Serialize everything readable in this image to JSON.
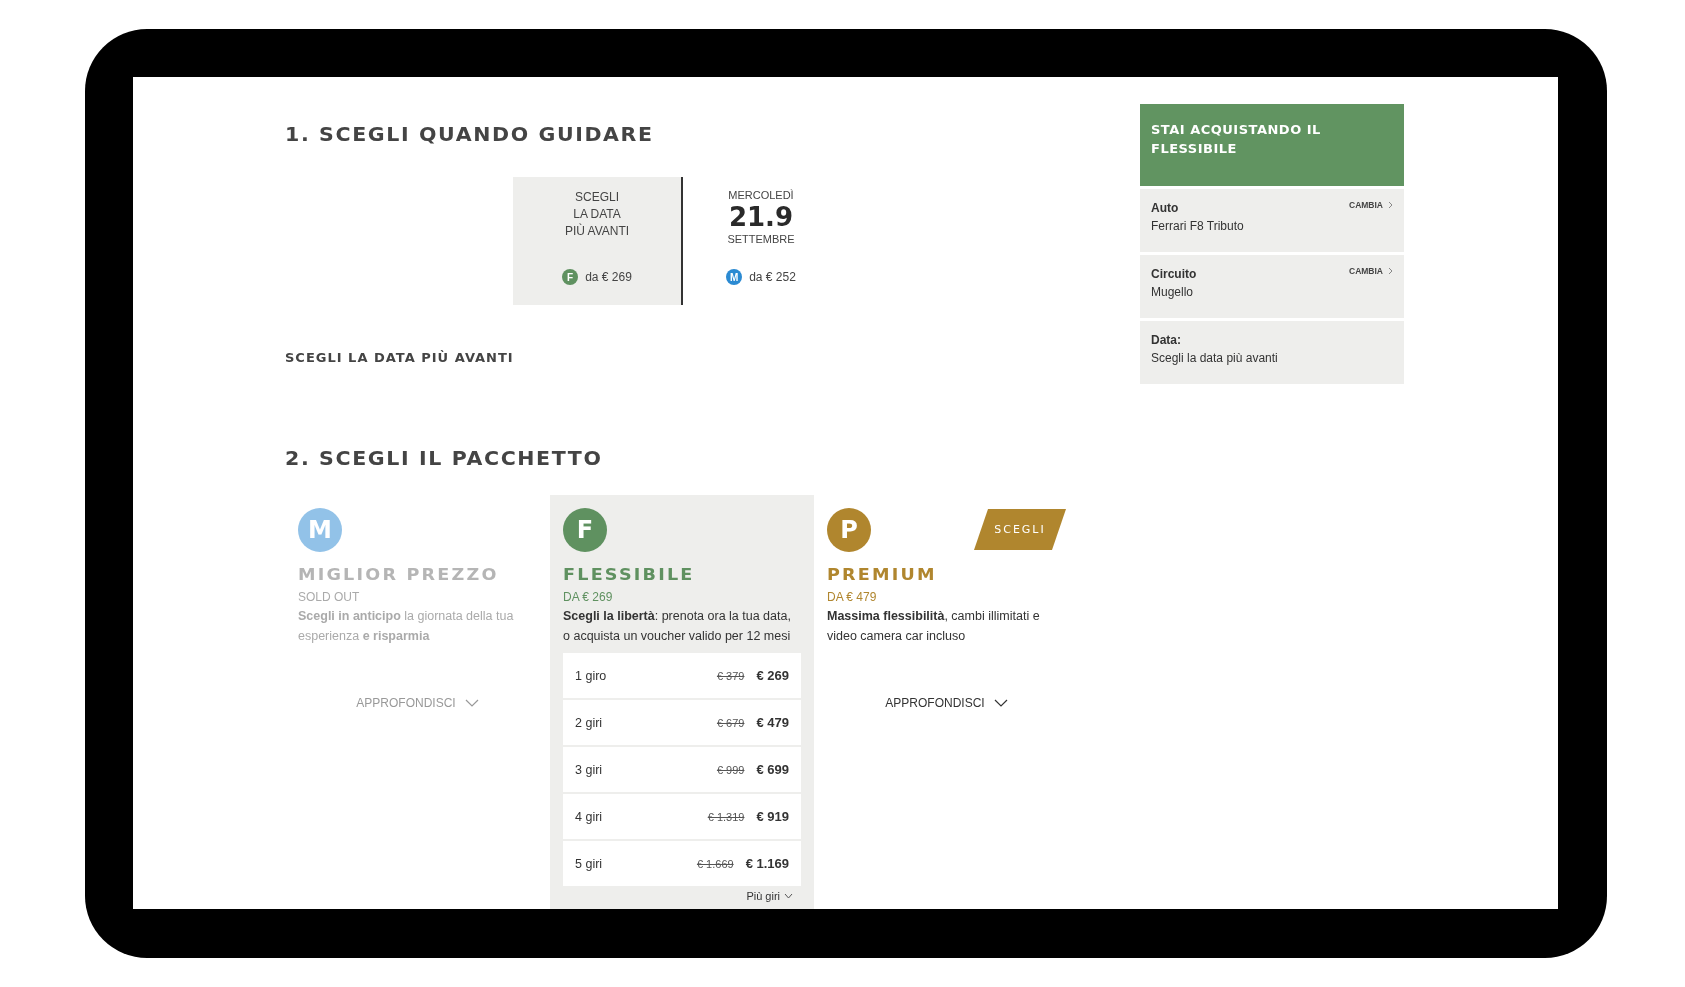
{
  "step1": {
    "title": "1. SCEGLI QUANDO GUIDARE",
    "date_options": [
      {
        "kind": "flexible",
        "lines": [
          "SCEGLI",
          "LA DATA",
          "PIÙ AVANTI"
        ],
        "badge": "F",
        "color": "#5f9160",
        "price": "da € 269",
        "selected": true
      },
      {
        "kind": "date",
        "weekday": "MERCOLEDÌ",
        "day": "21.9",
        "month": "SETTEMBRE",
        "badge": "M",
        "color": "#2b8ad2",
        "price": "da € 252",
        "selected": false
      }
    ],
    "selection_label": "SCEGLI LA DATA PIÙ AVANTI"
  },
  "step2": {
    "title": "2. SCEGLI IL PACCHETTO",
    "packages": [
      {
        "badge": "M",
        "name": "MIGLIOR PREZZO",
        "color": "#92c2e8",
        "status": "SOLD OUT",
        "sold_out": true,
        "selected": false,
        "description": "**Scegli in anticipo** la giornata della tua esperienza **e risparmia**",
        "more": "APPROFONDISCI"
      },
      {
        "badge": "F",
        "name": "FLESSIBILE",
        "color": "#5f9160",
        "price": "DA € 269",
        "sold_out": false,
        "selected": true,
        "description": "**Scegli la libertà**: prenota ora la tua data, o acquista un voucher valido per 12 mesi",
        "rows": [
          {
            "label": "1 giro",
            "old_price": "€ 379",
            "price": "€ 269"
          },
          {
            "label": "2 giri",
            "old_price": "€ 679",
            "price": "€ 479"
          },
          {
            "label": "3 giri",
            "old_price": "€ 999",
            "price": "€ 699"
          },
          {
            "label": "4 giri",
            "old_price": "€ 1.319",
            "price": "€ 919"
          },
          {
            "label": "5 giri",
            "old_price": "€ 1.669",
            "price": "€ 1.169"
          }
        ],
        "more_link": "Più giri"
      },
      {
        "badge": "P",
        "name": "PREMIUM",
        "color": "#b0862e",
        "price": "DA € 479",
        "sold_out": false,
        "selected": false,
        "action": "SCEGLI",
        "description": "**Massima flessibilità**, cambi illimitati e video camera car incluso",
        "more": "APPROFONDISCI"
      }
    ]
  },
  "summary": {
    "title": "STAI ACQUISTANDO IL FLESSIBILE",
    "items": [
      {
        "label": "Auto",
        "value": "Ferrari F8 Tributo",
        "action": "CAMBIA"
      },
      {
        "label": "Circuito",
        "value": "Mugello",
        "action": "CAMBIA"
      },
      {
        "label": "Data:",
        "value": "Scegli la data più avanti"
      }
    ]
  }
}
